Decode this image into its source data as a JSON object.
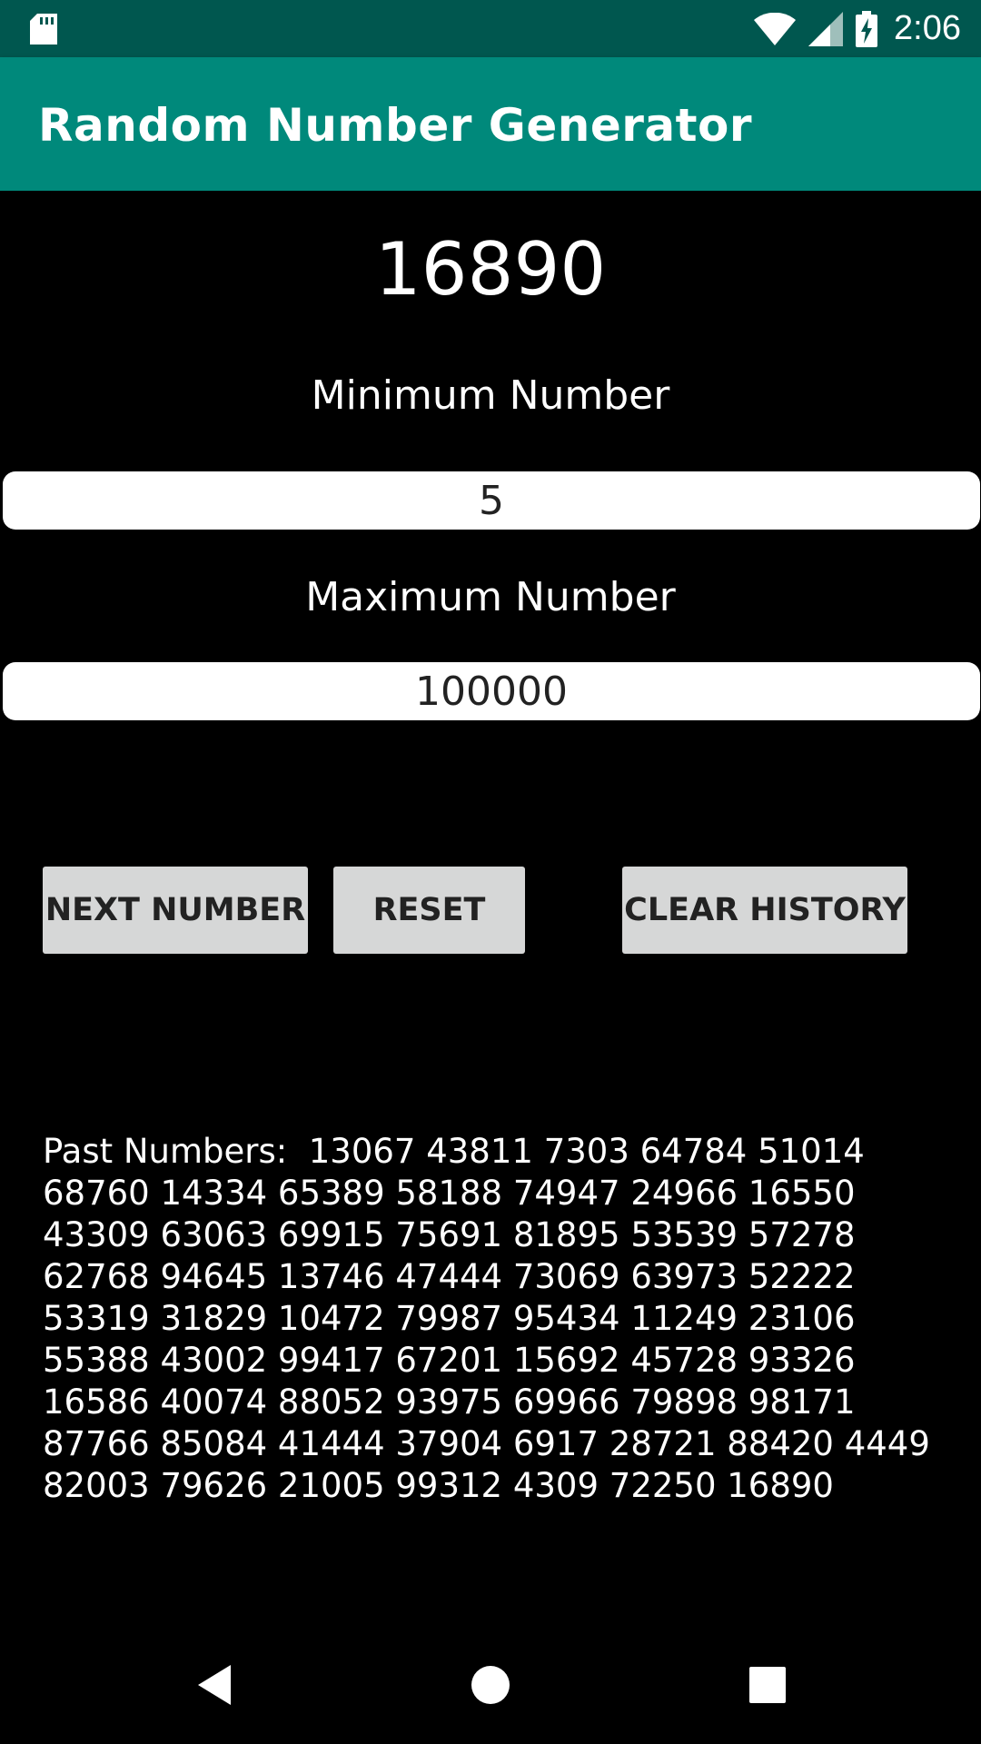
{
  "status_bar": {
    "time": "2:06",
    "icons": [
      "sd-card-icon",
      "wifi-icon",
      "cell-signal-icon",
      "battery-charging-icon"
    ]
  },
  "app_bar": {
    "title": "Random Number Generator",
    "color": "#00897b",
    "status_color": "#00574f"
  },
  "main": {
    "current_number": "16890",
    "min_label": "Minimum Number",
    "min_value": "5",
    "max_label": "Maximum Number",
    "max_value": "100000",
    "buttons": {
      "next": "NEXT NUMBER",
      "reset": "RESET",
      "clear": "CLEAR HISTORY"
    },
    "history_text": "Past Numbers:  13067 43811 7303 64784 51014\n68760 14334 65389 58188 74947 24966 16550\n43309 63063 69915 75691 81895 53539 57278\n62768 94645 13746 47444 73069 63973 52222\n53319 31829 10472 79987 95434 11249 23106\n55388 43002 99417 67201 15692 45728 93326\n16586 40074 88052 93975 69966 79898 98171\n87766 85084 41444 37904 6917 28721 88420 4449\n82003 79626 21005 99312 4309 72250 16890"
  },
  "nav_bar": {
    "icons": [
      "back-icon",
      "home-icon",
      "recents-icon"
    ]
  }
}
